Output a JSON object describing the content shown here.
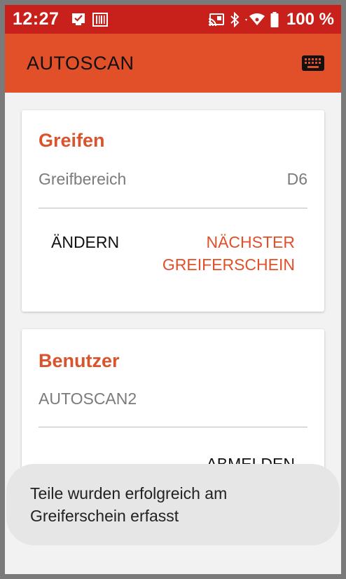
{
  "status_bar": {
    "time": "12:27",
    "battery": "100 %",
    "icons_left": [
      "checkmark-notification-icon",
      "barcode-icon"
    ],
    "icons_right": [
      "cast-icon",
      "bluetooth-icon",
      "wifi-icon",
      "battery-icon"
    ],
    "background": "#c8201a"
  },
  "app_bar": {
    "title": "AUTOSCAN",
    "action_icon": "keyboard-icon",
    "background": "#e2502a"
  },
  "greifen_card": {
    "title": "Greifen",
    "label": "Greifbereich",
    "value": "D6",
    "change_button": "ÄNDERN",
    "next_button": "NÄCHSTER GREIFERSCHEIN"
  },
  "benutzer_card": {
    "title": "Benutzer",
    "username": "AUTOSCAN2",
    "logout_button": "ABMELDEN"
  },
  "toast": {
    "message": "Teile wurden erfolgreich am Greiferschein erfasst"
  },
  "colors": {
    "accent": "#e2502a",
    "title_accent": "#d9532c",
    "card_bg": "#ffffff",
    "page_bg": "#f2f2f2"
  }
}
